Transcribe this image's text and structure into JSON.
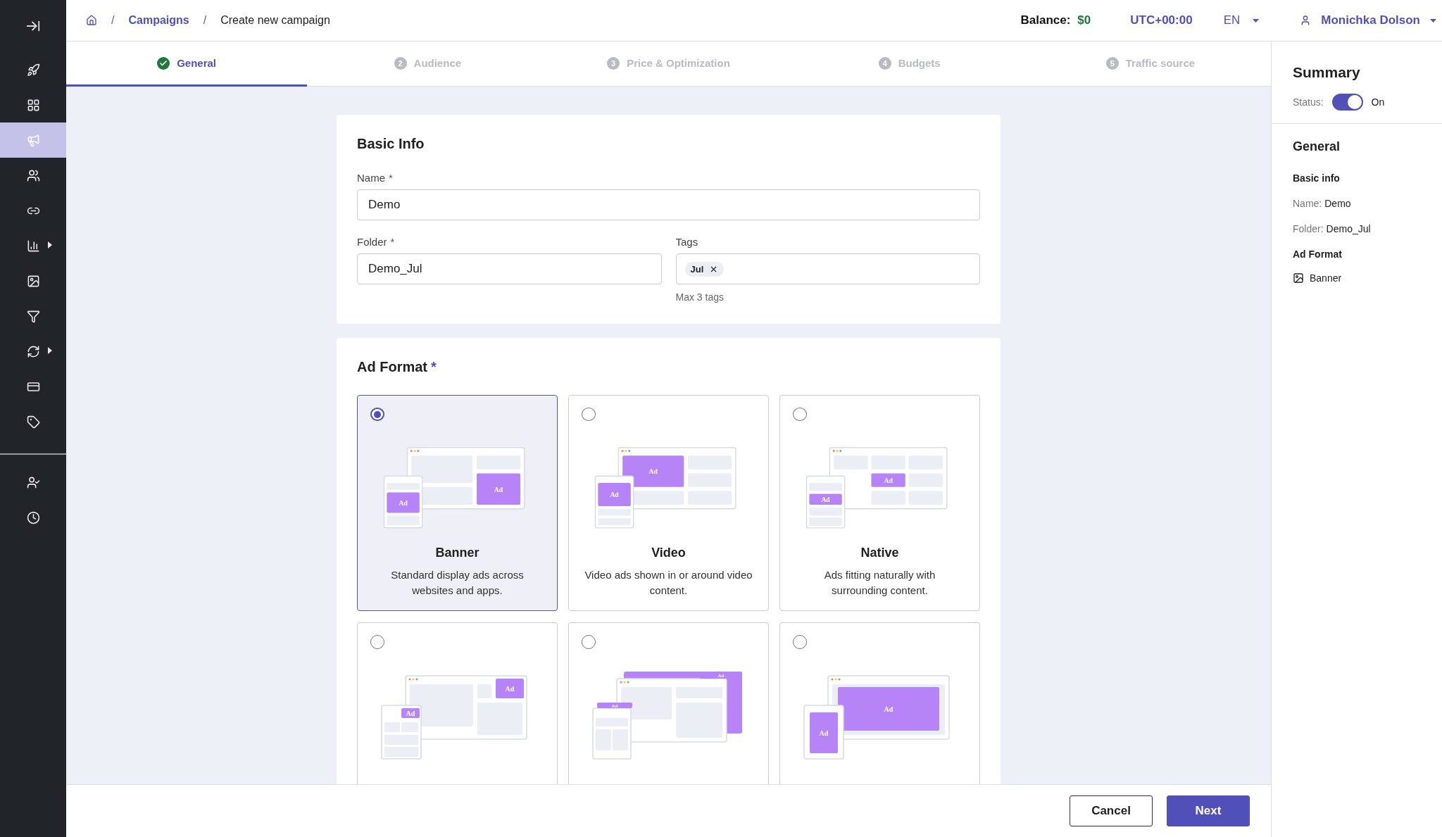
{
  "sidebar": {
    "items": [
      {
        "selected": false,
        "expandable": false
      },
      {
        "selected": false,
        "expandable": false
      },
      {
        "selected": true,
        "expandable": false
      },
      {
        "selected": false,
        "expandable": false
      },
      {
        "selected": false,
        "expandable": false
      },
      {
        "selected": false,
        "expandable": true
      },
      {
        "selected": false,
        "expandable": false
      },
      {
        "selected": false,
        "expandable": false
      },
      {
        "selected": false,
        "expandable": true
      },
      {
        "selected": false,
        "expandable": false
      },
      {
        "selected": false,
        "expandable": false
      }
    ],
    "bottom_items": [
      {
        "selected": false
      },
      {
        "selected": false
      }
    ]
  },
  "breadcrumb": [
    {
      "separator": "/",
      "label": "Campaigns",
      "link": true
    },
    {
      "separator": "/",
      "label": "Create new campaign",
      "link": false
    }
  ],
  "header": {
    "balance_label": "Balance:",
    "balance_value": "$0",
    "timezone": "UTC+00:00",
    "language": "EN",
    "user": "Monichka Dolson"
  },
  "steps": [
    {
      "label": "General",
      "selected": true,
      "completed": true
    },
    {
      "number": "2",
      "label": "Audience",
      "selected": false,
      "completed": false
    },
    {
      "number": "3",
      "label": "Price & Optimization",
      "selected": false,
      "completed": false
    },
    {
      "number": "4",
      "label": "Budgets",
      "selected": false,
      "completed": false
    },
    {
      "number": "5",
      "label": "Traffic source",
      "selected": false,
      "completed": false
    }
  ],
  "basic_info": {
    "title": "Basic Info",
    "name_label": "Name",
    "name_value": "Demo",
    "folder_label": "Folder",
    "folder_value": "Demo_Jul",
    "tags_label": "Tags",
    "tags": [
      "Jul"
    ],
    "tags_hint": "Max 3 tags",
    "required_mark": "*"
  },
  "ad_format": {
    "title": "Ad Format",
    "required_mark": "*",
    "options": [
      {
        "kind": "banner",
        "title": "Banner",
        "description": "Standard display ads across websites and apps.",
        "selected": true,
        "ad_labels": [
          "Ad",
          "Ad"
        ]
      },
      {
        "kind": "video",
        "title": "Video",
        "description": "Video ads shown in or around video content.",
        "selected": false,
        "ad_labels": [
          "Ad",
          "Ad"
        ]
      },
      {
        "kind": "native",
        "title": "Native",
        "description": "Ads fitting naturally with surrounding content.",
        "selected": false,
        "ad_labels": [
          "Ad",
          "Ad"
        ]
      },
      {
        "kind": "push",
        "selected": false,
        "ad_labels": [
          "Ad",
          "Ad"
        ]
      },
      {
        "kind": "popunder",
        "selected": false,
        "ad_labels": [
          "Ad",
          "Ad"
        ]
      },
      {
        "kind": "interstitial",
        "selected": false,
        "ad_labels": [
          "Ad",
          "Ad"
        ]
      }
    ]
  },
  "footer": {
    "buttons": [
      {
        "label": "Cancel",
        "kind": "secondary"
      },
      {
        "label": "Next",
        "kind": "primary"
      }
    ]
  },
  "summary": {
    "title": "Summary",
    "status_label": "Status:",
    "status_on": true,
    "status_text": "On",
    "section": "General",
    "groups": [
      {
        "title": "Basic info",
        "rows": [
          {
            "label": "Name:",
            "value": "Demo"
          },
          {
            "label": "Folder:",
            "value": "Demo_Jul"
          }
        ]
      },
      {
        "title": "Ad Format",
        "format": "Banner"
      }
    ]
  }
}
